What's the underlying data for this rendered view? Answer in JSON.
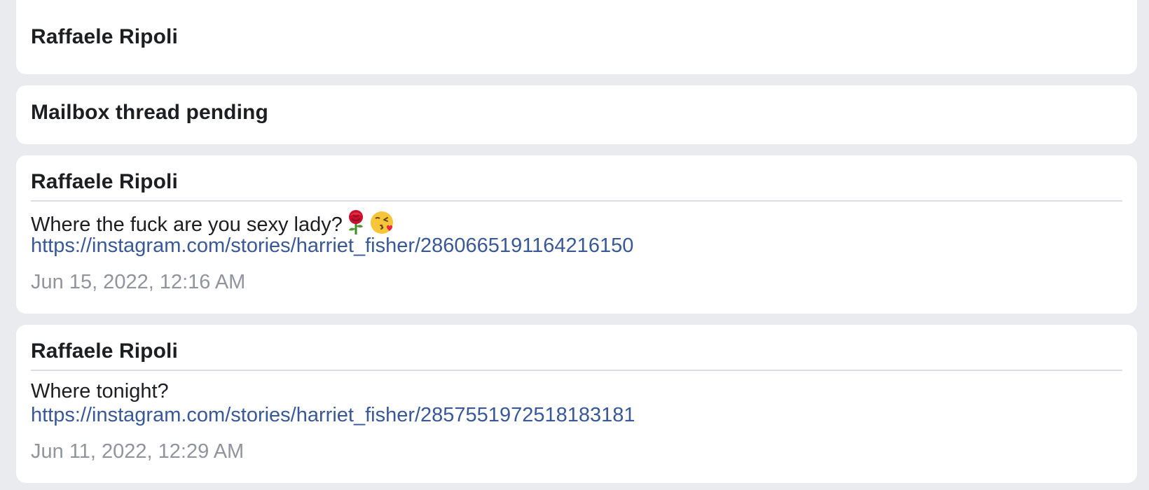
{
  "cards": [
    {
      "sender": "Raffaele Ripoli"
    },
    {
      "title": "Mailbox thread pending"
    },
    {
      "sender": "Raffaele Ripoli",
      "text": "Where the fuck are you sexy lady?",
      "emojis": [
        "rose-emoji",
        "face-blowing-kiss-emoji"
      ],
      "link": "https://instagram.com/stories/harriet_fisher/2860665191164216150",
      "timestamp": "Jun 15, 2022, 12:16 AM"
    },
    {
      "sender": "Raffaele Ripoli",
      "text": "Where tonight?",
      "link": "https://instagram.com/stories/harriet_fisher/2857551972518183181",
      "timestamp": "Jun 11, 2022, 12:29 AM"
    }
  ],
  "colors": {
    "page_background": "#e9ebee",
    "card_background": "#ffffff",
    "text": "#1c1e21",
    "link": "#385898",
    "timestamp": "#90949c",
    "divider": "#dadde1"
  }
}
